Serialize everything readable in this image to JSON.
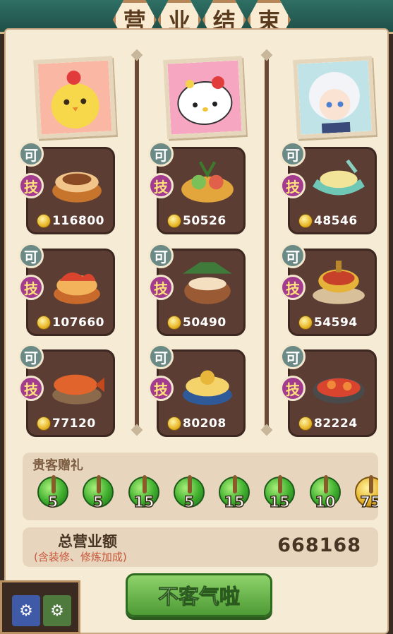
{
  "title": [
    "营",
    "业",
    "结",
    "束"
  ],
  "columns": [
    {
      "guest_icon": "chick-guest-portrait",
      "dishes": [
        {
          "art": "noodle-pot-dish",
          "price": "116800"
        },
        {
          "art": "lobster-bowl-dish",
          "price": "107660"
        },
        {
          "art": "braised-fish-dish",
          "price": "77120"
        }
      ]
    },
    {
      "guest_icon": "hello-kitty-guest-portrait",
      "dishes": [
        {
          "art": "seafood-platter-dish",
          "price": "50526"
        },
        {
          "art": "clay-pot-soup-dish",
          "price": "50490"
        },
        {
          "art": "blue-porcelain-feast-dish",
          "price": "80208"
        }
      ]
    },
    {
      "guest_icon": "silver-hair-guest-portrait",
      "dishes": [
        {
          "art": "jade-boat-dish",
          "price": "48546"
        },
        {
          "art": "hotpot-banquet-dish",
          "price": "54594"
        },
        {
          "art": "crab-feast-dish",
          "price": "82224"
        }
      ]
    }
  ],
  "badges": {
    "ke": "可",
    "ji": "技"
  },
  "gifts": {
    "title": "贵客赠礼",
    "items": [
      {
        "value": "5",
        "color": "green"
      },
      {
        "value": "5",
        "color": "green"
      },
      {
        "value": "15",
        "color": "green"
      },
      {
        "value": "5",
        "color": "green"
      },
      {
        "value": "15",
        "color": "green"
      },
      {
        "value": "15",
        "color": "green"
      },
      {
        "value": "10",
        "color": "green"
      },
      {
        "value": "75",
        "color": "gold"
      }
    ]
  },
  "total": {
    "label": "总营业额",
    "sub": "(含装修、修炼加成)",
    "value": "668168"
  },
  "confirm_label": "不客气啦",
  "corner_icons": [
    "scene-icon-blue",
    "scene-icon-green"
  ],
  "colors": {
    "panel": "#f6ecd6",
    "card": "#5b3d33",
    "badge_ke": "#6b8a86",
    "badge_ji": "#a33c8f",
    "button": "#6fbb4e"
  }
}
